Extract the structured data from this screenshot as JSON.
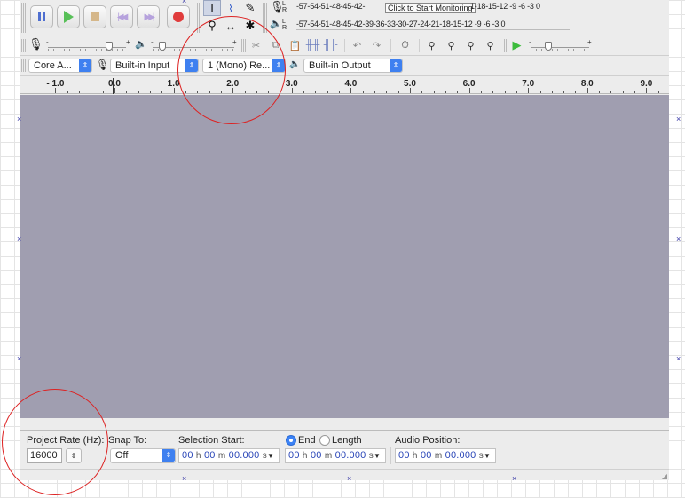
{
  "transport": {
    "buttons": [
      "pause",
      "play",
      "stop",
      "skip-to-start",
      "skip-to-end",
      "record"
    ]
  },
  "meters": {
    "record_channels": "L\nR",
    "playback_channels": "L\nR",
    "record_scale_left": "-57-54-51-48-45-42-",
    "monitor_tooltip": "Click to Start Monitoring",
    "record_scale_right": "1-18-15-12 -9  -6  -3  0",
    "playback_scale": "-57-54-51-48-45-42-39-36-33-30-27-24-21-18-15-12 -9  -6  -3  0"
  },
  "mixer": {
    "input_min": "-",
    "input_max": "+",
    "output_min": "-",
    "output_max": "+",
    "play_speed_min": "-",
    "play_speed_max": "+",
    "input_level": 0.78,
    "output_level": 0.12,
    "play_speed_level": 0.3
  },
  "devices": {
    "host": "Core A...",
    "input_device": "Built-in Input",
    "channels": "1 (Mono) Re...",
    "output_device": "Built-in Output"
  },
  "ruler": {
    "labels": [
      "- 1.0",
      "0.0",
      "1.0",
      "2.0",
      "3.0",
      "4.0",
      "5.0",
      "6.0",
      "7.0",
      "8.0",
      "9.0"
    ]
  },
  "selection_bar": {
    "project_rate_label": "Project Rate (Hz):",
    "project_rate_value": "16000",
    "snap_to_label": "Snap To:",
    "snap_to_value": "Off",
    "selection_start_label": "Selection Start:",
    "end_label": "End",
    "length_label": "Length",
    "audio_position_label": "Audio Position:",
    "time_h": "00",
    "time_m": "00",
    "time_s": "00.000",
    "unit_h": "h",
    "unit_m": "m",
    "unit_s": "s"
  },
  "colors": {
    "track_area": "#a09eb0",
    "annotation": "#dd2222"
  }
}
